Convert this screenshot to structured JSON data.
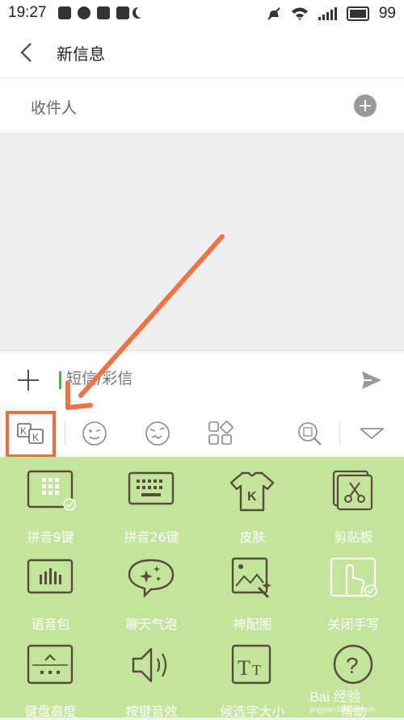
{
  "status_bar": {
    "time": "19:27",
    "battery": "99"
  },
  "header": {
    "title": "新信息"
  },
  "recipient": {
    "label": "收件人"
  },
  "compose": {
    "placeholder": "短信/彩信"
  },
  "panel": {
    "items": [
      {
        "label": "拼音9键",
        "icon": "pinyin9-icon"
      },
      {
        "label": "拼音26键",
        "icon": "pinyin26-icon"
      },
      {
        "label": "皮肤",
        "icon": "skin-icon"
      },
      {
        "label": "剪贴板",
        "icon": "clipboard-icon"
      },
      {
        "label": "语音包",
        "icon": "voice-pack-icon"
      },
      {
        "label": "聊天气泡",
        "icon": "chat-bubble-icon"
      },
      {
        "label": "神配图",
        "icon": "image-match-icon"
      },
      {
        "label": "关闭手写",
        "icon": "handwriting-icon"
      },
      {
        "label": "键盘高度",
        "icon": "keyboard-height-icon"
      },
      {
        "label": "按键音效",
        "icon": "key-sound-icon"
      },
      {
        "label": "候选字大小",
        "icon": "candidate-size-icon"
      },
      {
        "label": "帮助",
        "icon": "help-icon"
      }
    ]
  },
  "colors": {
    "panel_bg": "#c2e59b",
    "highlight": "#f26b3a",
    "icon_stroke": "#5a4a3a"
  },
  "watermark": {
    "text": "Bai 经验",
    "sub": "jingyan.baidu.com"
  }
}
